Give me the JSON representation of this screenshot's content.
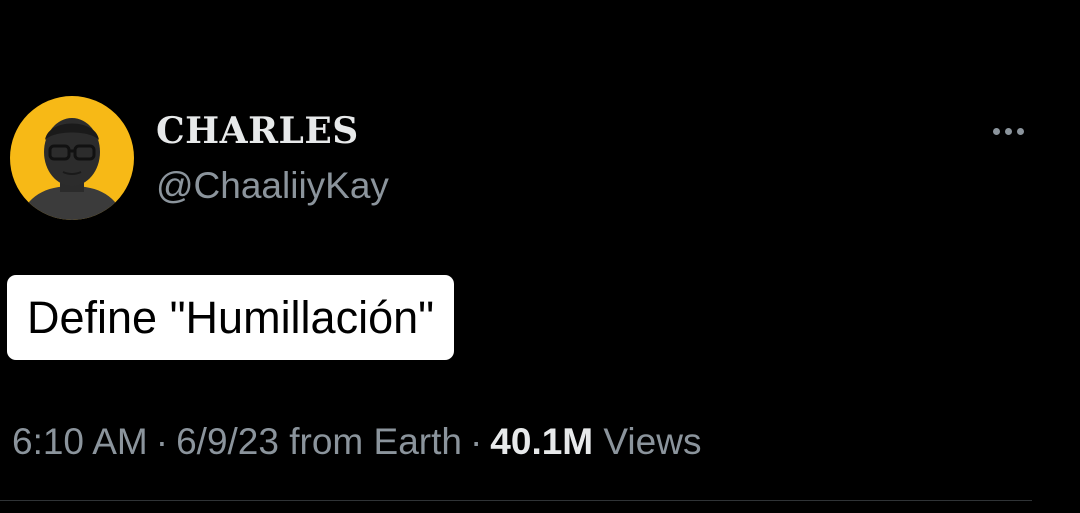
{
  "author": {
    "display_name": "CHARLES",
    "handle": "@ChaaliiyKay",
    "avatar_icon": "profile-avatar",
    "avatar_bg_color": "#f7b916"
  },
  "menu_icon": "more-options-icon",
  "tweet": {
    "text": "Define \"Humillación\""
  },
  "meta": {
    "time": "6:10 AM",
    "separator": "·",
    "date": "6/9/23",
    "source": "from Earth",
    "views_count": "40.1M",
    "views_label": "Views"
  },
  "colors": {
    "background": "#000000",
    "primary_text": "#e7e9ea",
    "secondary_text": "#8b949c",
    "highlight": "#ffffff"
  }
}
